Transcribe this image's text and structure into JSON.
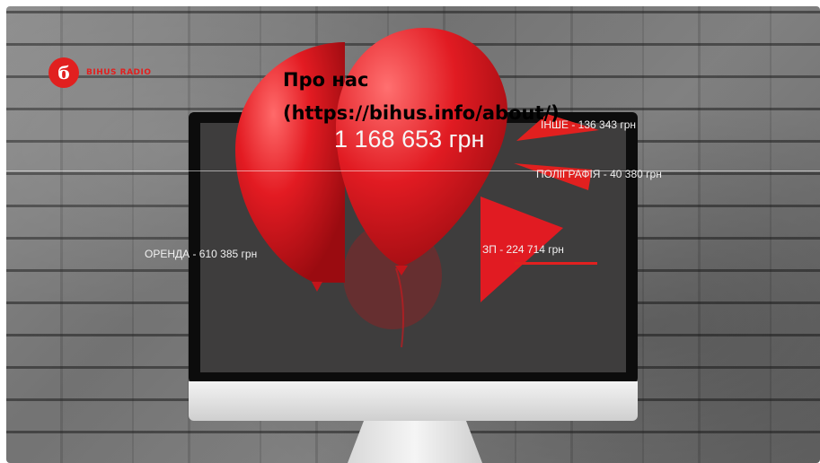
{
  "logo": {
    "mark": "б",
    "text": "BIHUS Radio"
  },
  "overlay": {
    "line1": "Про нас",
    "line2": "(https://bihus.info/about/)"
  },
  "chart": {
    "total": "1 168 653 грн",
    "labels": {
      "other": "ІНШЕ - 136 343 грн",
      "printing": "ПОЛІГРАФІЯ - 40 380 грн",
      "salary": "ЗП - 224 714 грн",
      "rent": "ОРЕНДА - 610 385 грн"
    }
  },
  "chart_data": {
    "type": "pie",
    "title": "1 168 653 грн",
    "categories": [
      "ОРЕНДА",
      "ЗП",
      "ІНШЕ",
      "ПОЛІГРАФІЯ"
    ],
    "values": [
      610385,
      224714,
      136343,
      40380
    ],
    "colors": {
      "balloon": "#e11b22",
      "accent": "#e1201f"
    }
  }
}
